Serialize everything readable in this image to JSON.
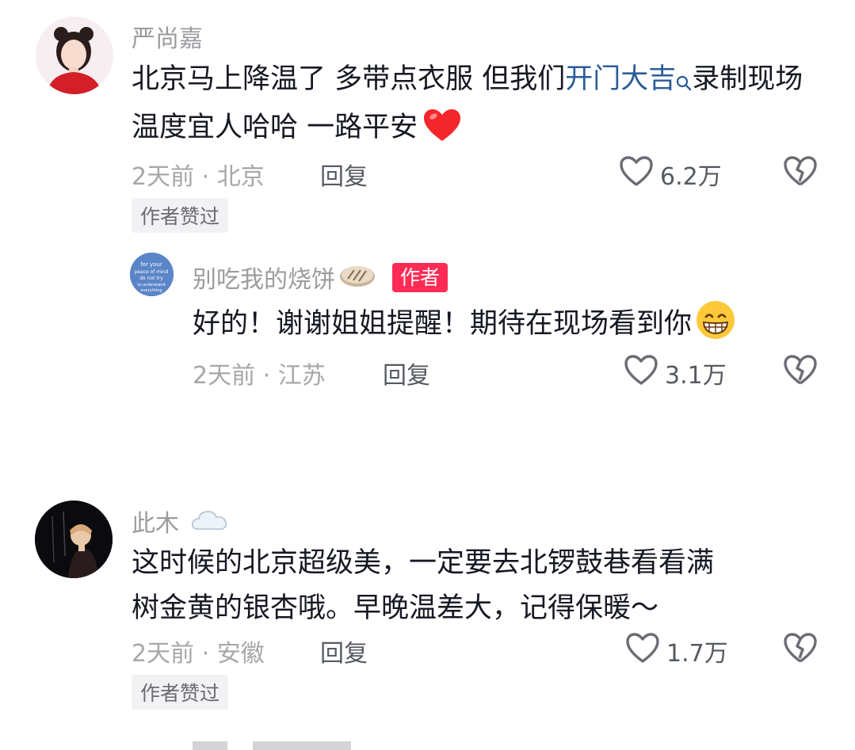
{
  "comments": [
    {
      "username": "严尚嘉",
      "text_before": "北京马上降温了 多带点衣服 但我们",
      "topic": "开门大吉",
      "text_after": "录制现场温度宜人哈哈 一路平安",
      "emoji": "red-heart",
      "time_location": "2天前 · 北京",
      "reply_label": "回复",
      "likes": "6.2万",
      "author_liked_tag": "作者赞过",
      "replies": [
        {
          "username": "别吃我的烧饼",
          "author_badge": "作者",
          "text": "好的！谢谢姐姐提醒！期待在现场看到你",
          "emoji": "grinning-face",
          "time_location": "2天前 · 江苏",
          "reply_label": "回复",
          "likes": "3.1万",
          "avatar_text": "for your peace of mind do not try to understand everything"
        }
      ]
    },
    {
      "username": "此木",
      "text_line1": "这时候的北京超级美，一定要去北锣鼓巷看看满",
      "text_line2": "树金黄的银杏哦。早晚温差大，记得保暖～",
      "time_location": "2天前 · 安徽",
      "reply_label": "回复",
      "likes": "1.7万",
      "author_liked_tag": "作者赞过"
    }
  ],
  "colors": {
    "topic_link": "#2b5c99",
    "author_badge": "#fe2c55",
    "text_primary": "#161823",
    "text_secondary": "#a7a7ab"
  }
}
